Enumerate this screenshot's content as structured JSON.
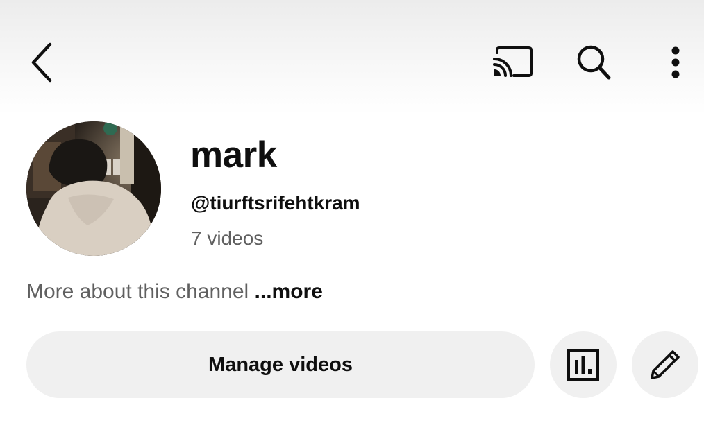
{
  "header": {
    "back_icon": "chevron-left-icon",
    "cast_icon": "cast-icon",
    "search_icon": "search-icon",
    "more_icon": "more-vertical-icon"
  },
  "channel": {
    "name": "mark",
    "handle": "@tiurftsrifehtkram",
    "video_count": "7 videos",
    "description": "More about this channel",
    "more_label": "...more"
  },
  "actions": {
    "manage_videos_label": "Manage videos",
    "analytics_icon": "analytics-icon",
    "edit_icon": "pencil-icon"
  },
  "colors": {
    "text_primary": "#0f0f0f",
    "text_secondary": "#606060",
    "button_bg": "#f0f0f0"
  }
}
